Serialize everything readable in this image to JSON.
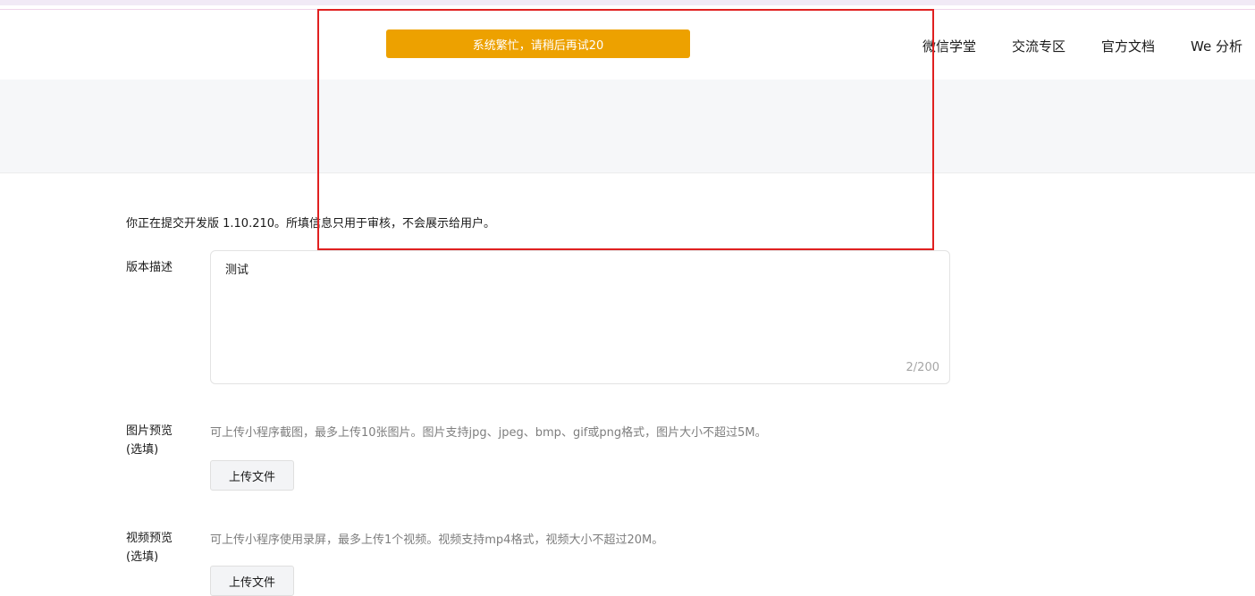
{
  "nav": {
    "items": [
      {
        "label": "微信学堂"
      },
      {
        "label": "交流专区"
      },
      {
        "label": "官方文档"
      },
      {
        "label": "We 分析"
      }
    ]
  },
  "toast": {
    "message": "系统繁忙，请稍后再试20",
    "color": "#eda100"
  },
  "form": {
    "intro": "你正在提交开发版 1.10.210。所填信息只用于审核，不会展示给用户。",
    "description": {
      "label": "版本描述",
      "value": "测试",
      "counter": "2/200"
    },
    "image_preview": {
      "label_line1": "图片预览",
      "label_line2": "(选填)",
      "hint": "可上传小程序截图，最多上传10张图片。图片支持jpg、jpeg、bmp、gif或png格式，图片大小不超过5M。",
      "button": "上传文件"
    },
    "video_preview": {
      "label_line1": "视频预览",
      "label_line2": "(选填)",
      "hint": "可上传小程序使用录屏，最多上传1个视频。视频支持mp4格式，视频大小不超过20M。",
      "button": "上传文件"
    }
  },
  "highlight_color": "#e02020"
}
